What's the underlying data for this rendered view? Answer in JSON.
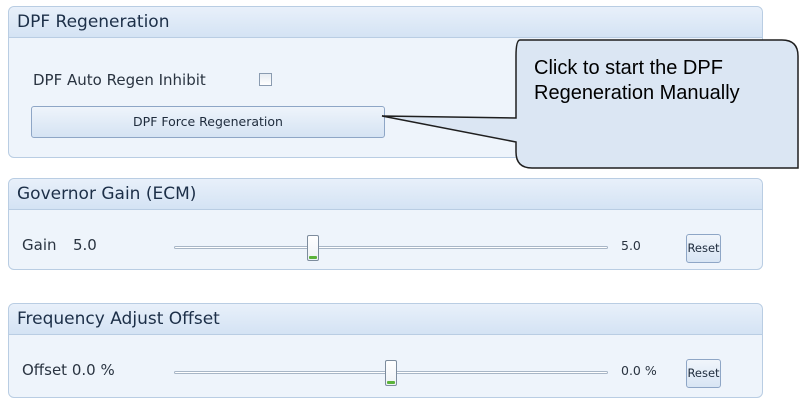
{
  "dpf_panel": {
    "title": "DPF Regeneration",
    "auto_regen_label": "DPF Auto Regen Inhibit",
    "auto_regen_checked": false,
    "force_button": "DPF Force Regeneration"
  },
  "governor_panel": {
    "title": "Governor Gain (ECM)",
    "gain_label": "Gain",
    "gain_value": "5.0",
    "max_value": "5.0",
    "slider_fraction": 0.32,
    "reset": "Reset"
  },
  "frequency_panel": {
    "title": "Frequency Adjust Offset",
    "offset_label": "Offset 0.0 %",
    "max_value": "0.0 %",
    "slider_fraction": 0.5,
    "reset": "Reset"
  },
  "callout": {
    "text": "Click to start the DPF Regeneration Manually"
  }
}
